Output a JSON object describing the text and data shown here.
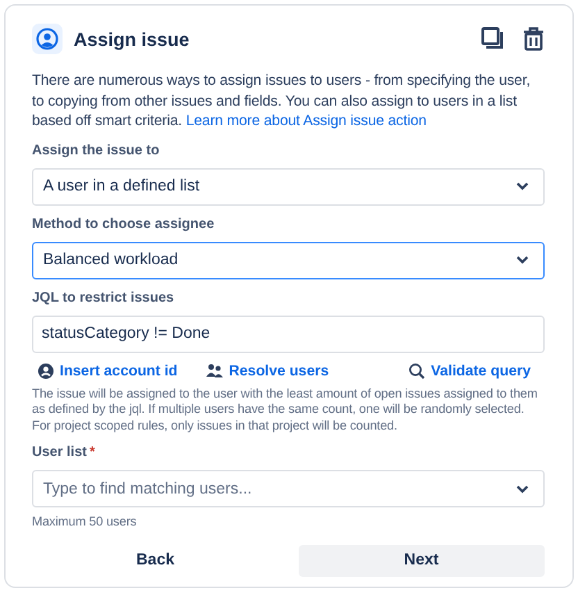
{
  "header": {
    "title": "Assign issue"
  },
  "description": {
    "text": "There are numerous ways to assign issues to users - from specifying the user, to copying from other issues and fields. You can also assign to users in a list based off smart criteria.",
    "link": "Learn more about Assign issue action"
  },
  "fields": [
    {
      "kind": "select",
      "label": "Assign the issue to",
      "value": "A user in a defined list",
      "focused": false,
      "required": false
    },
    {
      "kind": "select",
      "label": "Method to choose assignee",
      "value": "Balanced workload",
      "focused": true,
      "required": false
    },
    {
      "kind": "input",
      "label": "JQL to restrict issues",
      "value": "statusCategory != Done",
      "focused": false,
      "required": false,
      "links": [
        "Insert account id",
        "Resolve users",
        "Validate query"
      ],
      "help": "The issue will be assigned to the user with the least amount of open issues assigned to them as defined by the jql. If multiple users have the same count, one will be randomly selected. For project scoped rules, only issues in that project will be counted."
    },
    {
      "kind": "select",
      "label": "User list",
      "placeholder": "Type to find matching users...",
      "focused": false,
      "required": true,
      "required_mark": "*",
      "help": "Maximum 50 users"
    }
  ],
  "buttons": [
    {
      "label": "Back",
      "kind": "subtle"
    },
    {
      "label": "Next",
      "kind": "default"
    }
  ]
}
